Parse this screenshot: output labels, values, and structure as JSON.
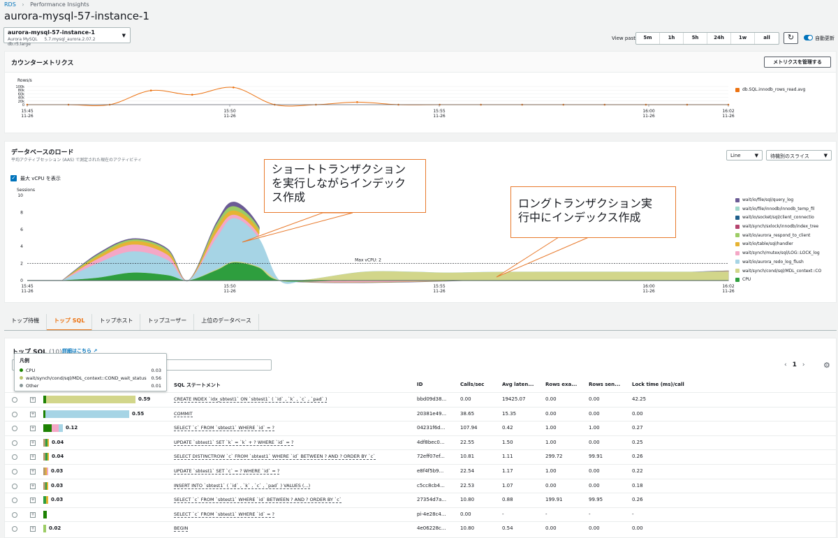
{
  "breadcrumb": {
    "root": "RDS",
    "current": "Performance Insights"
  },
  "page_title": "aurora-mysql-57-instance-1",
  "instance": {
    "name": "aurora-mysql-57-instance-1",
    "engine": "Aurora MySQL",
    "version": "5.7.mysql_aurora.2.07.2",
    "class": "db.r5.large"
  },
  "view_past": {
    "label": "View past",
    "options": [
      "5m",
      "1h",
      "5h",
      "24h",
      "1w",
      "all"
    ]
  },
  "auto_refresh": "自動更新",
  "counter": {
    "title": "カウンターメトリクス",
    "manage_button": "メトリクスを管理する",
    "legend": "db.SQL.innodb_rows_read.avg"
  },
  "load": {
    "title": "データベースのロード",
    "subtitle": "平均アクティブセッション (AAS) で測定された現在のアクティビティ",
    "view_select": "Line",
    "slice_select": "待機別のスライス",
    "show_vcpu": "最大 vCPU を表示",
    "max_vcpu_label": "Max vCPU: 2"
  },
  "callouts": {
    "short": "ショートトランザクション\nを実行しながらインデック\nス作成",
    "long": "ロングトランザクション実\n行中にインデックス作成"
  },
  "tabs": [
    "トップ待機",
    "トップ SQL",
    "トップホスト",
    "トップユーザー",
    "上位のデータベース"
  ],
  "top_sql": {
    "title": "トップ SQL",
    "count": "(10)",
    "detail_link": "詳細はこちら",
    "page": "1",
    "columns": [
      "SQL ステートメント",
      "ID",
      "Calls/sec",
      "Avg laten...",
      "Rows exa...",
      "Rows sen...",
      "Lock time (ms)/call"
    ],
    "rows": [
      {
        "load": "0.59",
        "sql": "CREATE INDEX `idx_sbtest1` ON `sbtest1` ( `id` , `k` , `c` , `pad` )",
        "id": "bbd09d38...",
        "calls": "0.00",
        "lat": "19425.07",
        "rexa": "0.00",
        "rsen": "0.00",
        "lock": "42.25"
      },
      {
        "load": "0.55",
        "sql": "COMMIT",
        "id": "20381e49...",
        "calls": "38.65",
        "lat": "15.35",
        "rexa": "0.00",
        "rsen": "0.00",
        "lock": "0.00"
      },
      {
        "load": "0.12",
        "sql": "SELECT `c` FROM `sbtest1` WHERE `id` = ?",
        "id": "04231f6d...",
        "calls": "107.94",
        "lat": "0.42",
        "rexa": "1.00",
        "rsen": "1.00",
        "lock": "0.27"
      },
      {
        "load": "0.04",
        "sql": "UPDATE `sbtest1` SET `k` = `k` + ? WHERE `id` = ?",
        "id": "4df8bec0...",
        "calls": "22.55",
        "lat": "1.50",
        "rexa": "1.00",
        "rsen": "0.00",
        "lock": "0.25"
      },
      {
        "load": "0.04",
        "sql": "SELECT DISTINCTROW `c` FROM `sbtest1` WHERE `id` BETWEEN ? AND ? ORDER BY `c`",
        "id": "72eff07ef...",
        "calls": "10.81",
        "lat": "1.11",
        "rexa": "299.72",
        "rsen": "99.91",
        "lock": "0.26"
      },
      {
        "load": "0.03",
        "sql": "UPDATE `sbtest1` SET `c` = ? WHERE `id` = ?",
        "id": "e8f4f5b9...",
        "calls": "22.54",
        "lat": "1.17",
        "rexa": "1.00",
        "rsen": "0.00",
        "lock": "0.22"
      },
      {
        "load": "0.03",
        "sql": "INSERT INTO `sbtest1` ( `id` , `k` , `c` , `pad` ) VALUES (...)",
        "id": "c5cc8cb4...",
        "calls": "22.53",
        "lat": "1.07",
        "rexa": "0.00",
        "rsen": "0.00",
        "lock": "0.18"
      },
      {
        "load": "0.03",
        "sql": "SELECT `c` FROM `sbtest1` WHERE `id` BETWEEN ? AND ? ORDER BY `c`",
        "id": "27354d7a...",
        "calls": "10.80",
        "lat": "0.88",
        "rexa": "199.91",
        "rsen": "99.95",
        "lock": "0.26"
      },
      {
        "load": "",
        "sql": "SELECT `c` FROM `sbtest1` WHERE `id` = ?",
        "id": "pi-4e28c4...",
        "calls": "0.00",
        "lat": "-",
        "rexa": "-",
        "rsen": "-",
        "lock": "-"
      },
      {
        "load": "0.02",
        "sql": "BEGIN",
        "id": "4e06228c...",
        "calls": "10.80",
        "lat": "0.54",
        "rexa": "0.00",
        "rsen": "0.00",
        "lock": "0.00"
      }
    ]
  },
  "tooltip": {
    "title": "凡例",
    "items": [
      {
        "name": "CPU",
        "value": "0.03",
        "color": "#1d8102"
      },
      {
        "name": "wait/synch/cond/sql/MDL_context::COND_wait_status",
        "value": "0.56",
        "color": "#b7c56b"
      },
      {
        "name": "Other",
        "value": "0.01",
        "color": "#879596"
      }
    ]
  },
  "chart_data": [
    {
      "type": "line",
      "title": "",
      "ylabel": "Rows/s",
      "yticks": [
        "100k",
        "80k",
        "60k",
        "40k",
        "20k",
        "0"
      ],
      "xticks": [
        "15:45\n11-26",
        "15:50\n11-26",
        "15:55\n11-26",
        "16:00\n11-26",
        "16:02\n11-26"
      ],
      "x": [
        "15:45",
        "15:46",
        "15:47",
        "15:48",
        "15:49",
        "15:50",
        "15:51",
        "15:52",
        "15:53",
        "15:54",
        "15:55",
        "15:56",
        "15:57",
        "15:58",
        "15:59",
        "16:00",
        "16:01",
        "16:02"
      ],
      "series": [
        {
          "name": "db.SQL.innodb_rows_read.avg",
          "values": [
            0,
            0,
            0,
            78000,
            55000,
            95000,
            0,
            0,
            14000,
            0,
            0,
            0,
            0,
            0,
            0,
            0,
            0,
            0
          ]
        }
      ]
    },
    {
      "type": "area",
      "title": "",
      "ylabel": "Sessions",
      "ylim": [
        0,
        10
      ],
      "yticks": [
        "10",
        "8",
        "6",
        "4",
        "2",
        "0"
      ],
      "xticks": [
        "15:45\n11-26",
        "15:50\n11-26",
        "15:55\n11-26",
        "16:00\n11-26",
        "16:02\n11-26"
      ],
      "legend": [
        "wait/io/file/sql/query_log",
        "wait/io/file/innodb/innodb_temp_fil",
        "wait/io/socket/sql/client_connectio",
        "wait/synch/sxlock/innodb/index_tree",
        "wait/io/aurora_respond_to_client",
        "wait/io/table/sql/handler",
        "wait/synch/mutex/sql/LOG::LOCK_log",
        "wait/io/aurora_redo_log_flush",
        "wait/synch/cond/sql/MDL_context::CO",
        "CPU"
      ],
      "legend_colors": [
        "#6b5b95",
        "#9fd8cb",
        "#1f5f8b",
        "#b5446e",
        "#9ccc65",
        "#e6b333",
        "#f4a7c6",
        "#a6d4e5",
        "#d2d68a",
        "#2e9e3e"
      ],
      "max_vcpu": 2
    }
  ]
}
